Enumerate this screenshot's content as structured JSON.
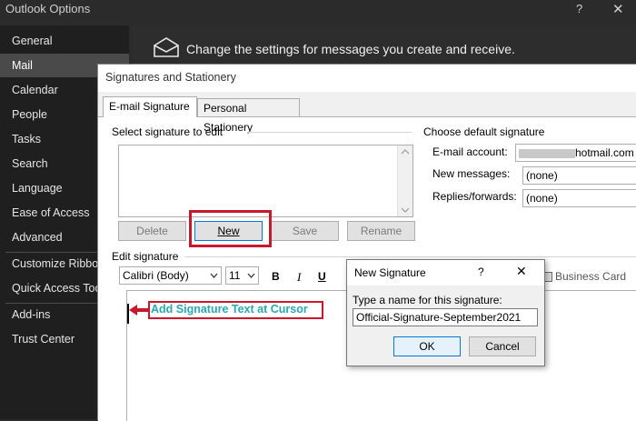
{
  "window": {
    "title": "Outlook Options",
    "help": "?",
    "close": "✕"
  },
  "sidebar": {
    "items": [
      {
        "label": "General"
      },
      {
        "label": "Mail"
      },
      {
        "label": "Calendar"
      },
      {
        "label": "People"
      },
      {
        "label": "Tasks"
      },
      {
        "label": "Search"
      },
      {
        "label": "Language"
      },
      {
        "label": "Ease of Access"
      },
      {
        "label": "Advanced"
      },
      {
        "label": "Customize Ribbon"
      },
      {
        "label": "Quick Access Toolbar"
      },
      {
        "label": "Add-ins"
      },
      {
        "label": "Trust Center"
      }
    ]
  },
  "main": {
    "heading": "Change the settings for messages you create and receive."
  },
  "signatures": {
    "title": "Signatures and Stationery",
    "tabs": [
      {
        "label": "E-mail Signature"
      },
      {
        "label": "Personal Stationery"
      }
    ],
    "select_label": "Select signature to edit",
    "buttons": {
      "delete": "Delete",
      "new": "New",
      "save": "Save",
      "rename": "Rename"
    },
    "default_sig": {
      "heading": "Choose default signature",
      "email_label": "E-mail account:",
      "email_value": "hotmail.com",
      "new_label": "New messages:",
      "new_value": "(none)",
      "reply_label": "Replies/forwards:",
      "reply_value": "(none)"
    },
    "edit": {
      "label": "Edit signature",
      "font": "Calibri (Body)",
      "size": "11",
      "bold": "B",
      "italic": "I",
      "underline": "U",
      "business_card": "Business Card",
      "annotation": "Add Signature Text at Cursor"
    }
  },
  "new_signature": {
    "title": "New Signature",
    "help": "?",
    "close": "✕",
    "prompt": "Type a name for this signature:",
    "value": "Official-Signature-September2021",
    "ok": "OK",
    "cancel": "Cancel"
  },
  "colors": {
    "highlight": "#c8192c",
    "annotation_text": "#2aa8b5",
    "accent": "#0078d7"
  }
}
